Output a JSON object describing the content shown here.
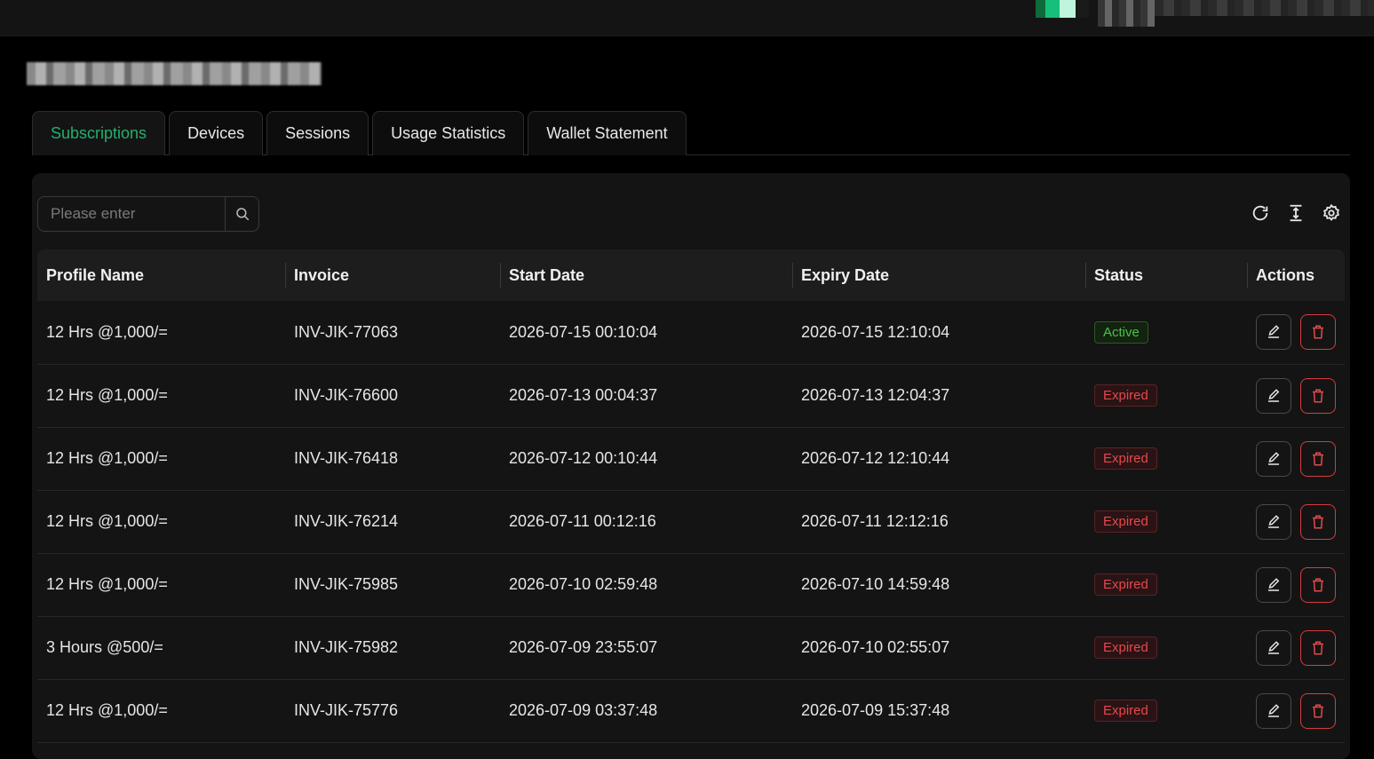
{
  "tabs": [
    {
      "label": "Subscriptions",
      "active": true
    },
    {
      "label": "Devices",
      "active": false
    },
    {
      "label": "Sessions",
      "active": false
    },
    {
      "label": "Usage Statistics",
      "active": false
    },
    {
      "label": "Wallet Statement",
      "active": false
    }
  ],
  "search": {
    "placeholder": "Please enter",
    "icon": "search-icon"
  },
  "toolbar": {
    "icons": [
      "refresh-icon",
      "column-height-icon",
      "settings-icon"
    ]
  },
  "table": {
    "columns": [
      "Profile Name",
      "Invoice",
      "Start Date",
      "Expiry Date",
      "Status",
      "Actions"
    ],
    "rows": [
      {
        "profile": "12 Hrs @1,000/=",
        "invoice": "INV-JIK-77063",
        "start": "2026-07-15 00:10:04",
        "expiry": "2026-07-15 12:10:04",
        "status": "Active"
      },
      {
        "profile": "12 Hrs @1,000/=",
        "invoice": "INV-JIK-76600",
        "start": "2026-07-13 00:04:37",
        "expiry": "2026-07-13 12:04:37",
        "status": "Expired"
      },
      {
        "profile": "12 Hrs @1,000/=",
        "invoice": "INV-JIK-76418",
        "start": "2026-07-12 00:10:44",
        "expiry": "2026-07-12 12:10:44",
        "status": "Expired"
      },
      {
        "profile": "12 Hrs @1,000/=",
        "invoice": "INV-JIK-76214",
        "start": "2026-07-11 00:12:16",
        "expiry": "2026-07-11 12:12:16",
        "status": "Expired"
      },
      {
        "profile": "12 Hrs @1,000/=",
        "invoice": "INV-JIK-75985",
        "start": "2026-07-10 02:59:48",
        "expiry": "2026-07-10 14:59:48",
        "status": "Expired"
      },
      {
        "profile": "3 Hours @500/=",
        "invoice": "INV-JIK-75982",
        "start": "2026-07-09 23:55:07",
        "expiry": "2026-07-10 02:55:07",
        "status": "Expired"
      },
      {
        "profile": "12 Hrs @1,000/=",
        "invoice": "INV-JIK-75776",
        "start": "2026-07-09 03:37:48",
        "expiry": "2026-07-09 15:37:48",
        "status": "Expired"
      }
    ]
  },
  "colors": {
    "accent": "#22b070",
    "active": "#49c24a",
    "expired": "#e5484d"
  }
}
